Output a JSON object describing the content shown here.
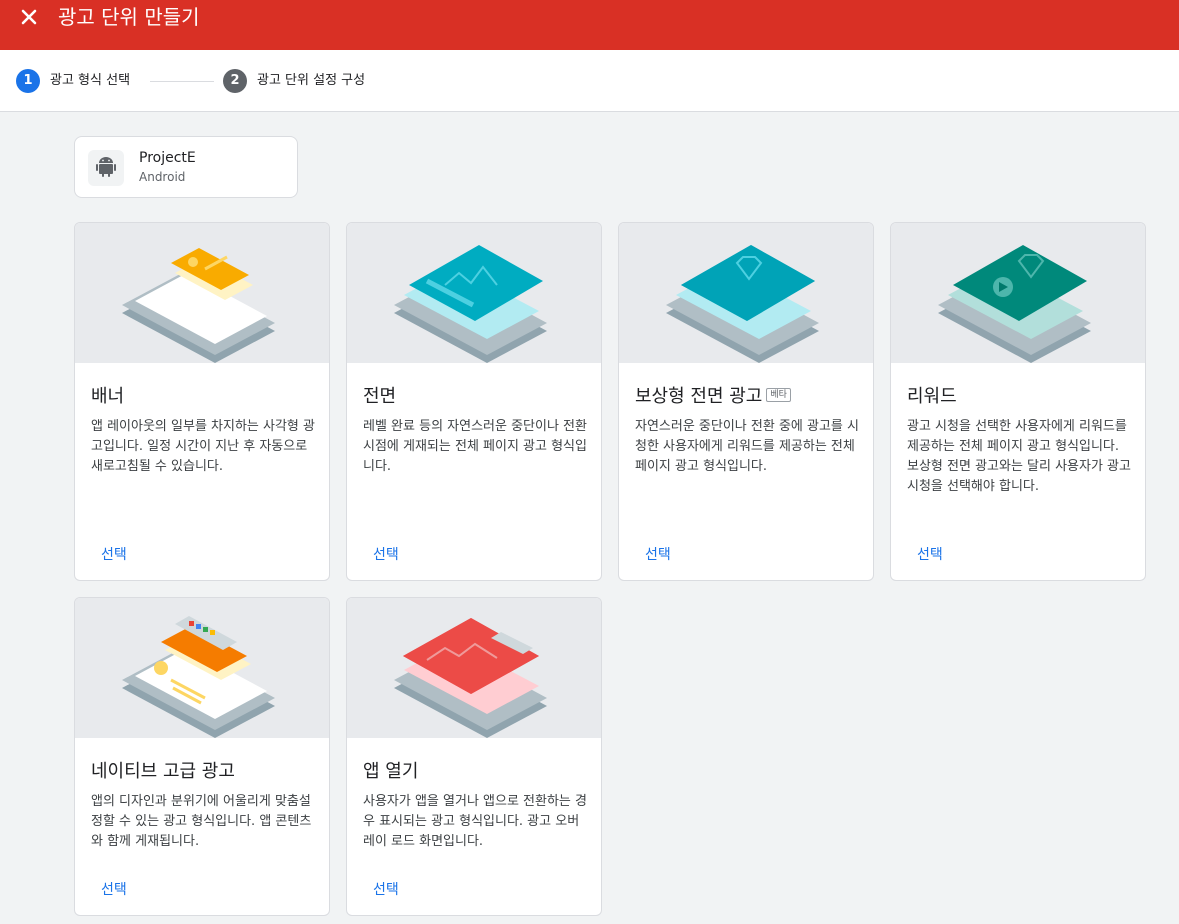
{
  "header": {
    "title": "광고 단위 만들기",
    "close_icon": "close-icon",
    "color": "#d93025"
  },
  "stepper": {
    "steps": [
      {
        "number": "1",
        "label": "광고 형식 선택",
        "state": "active",
        "color": "#1a73e8"
      },
      {
        "number": "2",
        "label": "광고 단위 설정 구성",
        "state": "inactive",
        "color": "#5f6368"
      }
    ]
  },
  "app": {
    "name": "ProjectE",
    "platform": "Android",
    "icon": "android-icon"
  },
  "formats": [
    {
      "title": "배너",
      "badge": "",
      "description": "앱 레이아웃의 일부를 차지하는 사각형 광고입니다. 일정 시간이 지난 후 자동으로 새로고침될 수 있습니다.",
      "action": "선택"
    },
    {
      "title": "전면",
      "badge": "",
      "description": "레벨 완료 등의 자연스러운 중단이나 전환 시점에 게재되는 전체 페이지 광고 형식입니다.",
      "action": "선택"
    },
    {
      "title": "보상형 전면 광고",
      "badge": "베타",
      "description": "자연스러운 중단이나 전환 중에 광고를 시청한 사용자에게 리워드를 제공하는 전체 페이지 광고 형식입니다.",
      "action": "선택"
    },
    {
      "title": "리워드",
      "badge": "",
      "description": "광고 시청을 선택한 사용자에게 리워드를 제공하는 전체 페이지 광고 형식입니다. 보상형 전면 광고와는 달리 사용자가 광고 시청을 선택해야 합니다.",
      "action": "선택"
    },
    {
      "title": "네이티브 고급 광고",
      "badge": "",
      "description": "앱의 디자인과 분위기에 어울리게 맞춤설정할 수 있는 광고 형식입니다. 앱 콘텐츠와 함께 게재됩니다.",
      "action": "선택"
    },
    {
      "title": "앱 열기",
      "badge": "",
      "description": "사용자가 앱을 열거나 앱으로 전환하는 경우 표시되는 광고 형식입니다. 광고 오버레이 로드 화면입니다.",
      "action": "선택"
    }
  ]
}
